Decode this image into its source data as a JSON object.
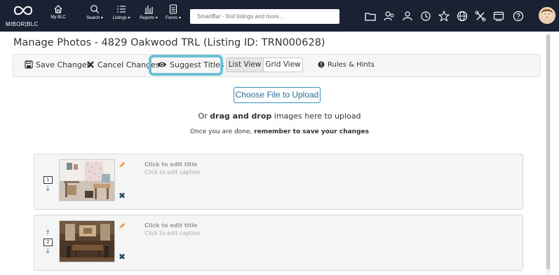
{
  "topbar": {
    "logo_text": "MIBOR|BLC",
    "nav": [
      {
        "label": "My BLC",
        "icon": "home-icon"
      },
      {
        "label": "Search ▾",
        "icon": "search-icon"
      },
      {
        "label": "Listings ▾",
        "icon": "list-icon"
      },
      {
        "label": "Reports ▾",
        "icon": "bar-chart-icon"
      },
      {
        "label": "Forms ▾",
        "icon": "document-icon"
      }
    ],
    "smartbar_placeholder": "SmartBar - find listings and more...",
    "right_icons": [
      "folder-icon",
      "contacts-icon",
      "user-icon",
      "history-icon",
      "star-icon",
      "globe-icon",
      "tools-icon",
      "window-icon",
      "help-icon",
      "avatar"
    ]
  },
  "page": {
    "title": "Manage Photos - 4829 Oakwood TRL (Listing ID: TRN000628)"
  },
  "toolbar": {
    "save": "Save Changes",
    "cancel": "Cancel Changes",
    "suggest": "Suggest Titles",
    "list_view": "List View",
    "grid_view": "Grid View",
    "rules": "Rules & Hints",
    "highlight_color": "#6cc1d6"
  },
  "upload": {
    "button": "Choose File to Upload",
    "drag_prefix": "Or ",
    "drag_bold": "drag and drop",
    "drag_suffix": " images here to upload",
    "save_prefix": "Once you are done, ",
    "save_bold": "remember to save your changes"
  },
  "photos": [
    {
      "order": "1",
      "title": "Click to edit title",
      "caption": "Click to edit caption"
    },
    {
      "order": "2",
      "title": "Click to edit title",
      "caption": "Click to edit caption"
    }
  ]
}
